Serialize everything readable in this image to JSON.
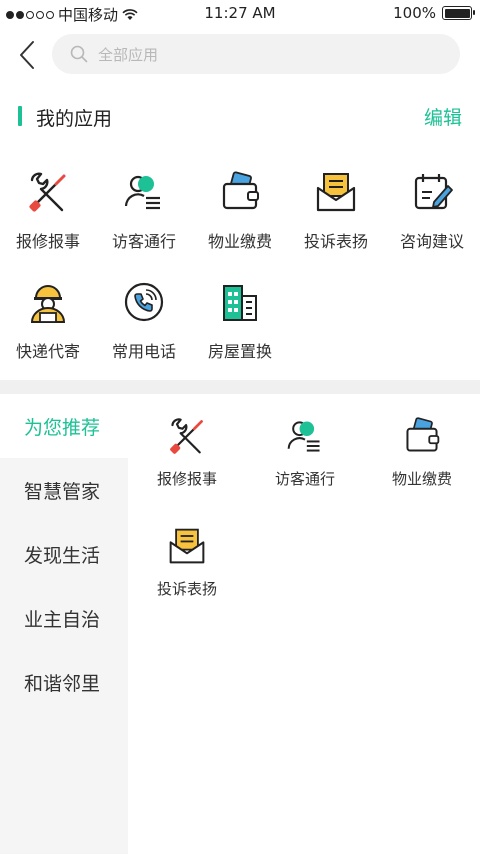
{
  "status_bar": {
    "carrier": "中国移动",
    "time": "11:27 AM",
    "battery_percent_text": "100%",
    "battery_level": 1.0,
    "signal_bars_filled": 2,
    "signal_bars_total": 5
  },
  "search": {
    "placeholder": "全部应用"
  },
  "my_apps": {
    "title": "我的应用",
    "edit_label": "编辑",
    "items": [
      {
        "label": "报修报事",
        "icon": "repair-tools-icon"
      },
      {
        "label": "访客通行",
        "icon": "visitor-icon"
      },
      {
        "label": "物业缴费",
        "icon": "wallet-icon"
      },
      {
        "label": "投诉表扬",
        "icon": "mail-icon"
      },
      {
        "label": "咨询建议",
        "icon": "calendar-edit-icon"
      },
      {
        "label": "快递代寄",
        "icon": "courier-icon"
      },
      {
        "label": "常用电话",
        "icon": "phone-icon"
      },
      {
        "label": "房屋置换",
        "icon": "building-icon"
      }
    ]
  },
  "recommend": {
    "tabs": [
      {
        "label": "为您推荐",
        "active": true
      },
      {
        "label": "智慧管家",
        "active": false
      },
      {
        "label": "发现生活",
        "active": false
      },
      {
        "label": "业主自治",
        "active": false
      },
      {
        "label": "和谐邻里",
        "active": false
      }
    ],
    "items": [
      {
        "label": "报修报事",
        "icon": "repair-tools-icon"
      },
      {
        "label": "访客通行",
        "icon": "visitor-icon"
      },
      {
        "label": "物业缴费",
        "icon": "wallet-icon"
      },
      {
        "label": "投诉表扬",
        "icon": "mail-icon"
      }
    ]
  },
  "colors": {
    "accent": "#1dc195",
    "red": "#e94a3f",
    "yellow": "#f7c23d",
    "blue": "#4aa3df",
    "dark": "#222222"
  }
}
